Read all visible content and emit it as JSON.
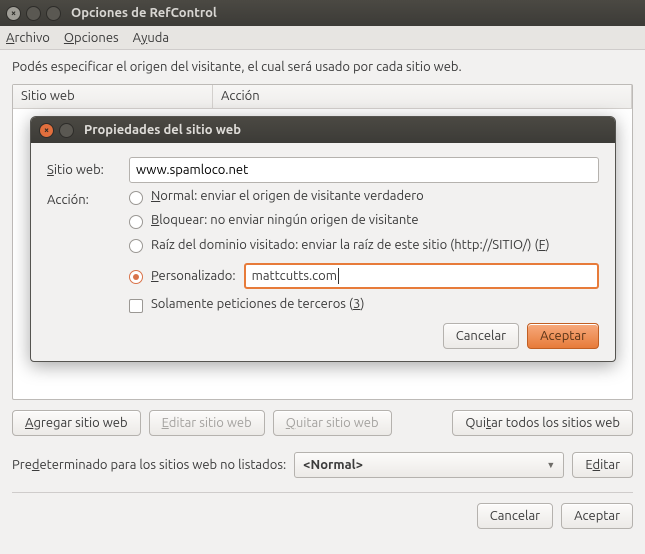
{
  "window": {
    "title": "Opciones de RefControl"
  },
  "menubar": {
    "file_html": "<u class='hint'>A</u>rchivo",
    "options_html": "<u class='hint'>O</u>pciones",
    "help_html": "A<u class='hint'>y</u>uda"
  },
  "main": {
    "description": "Podés especificar el origen del visitante, el cual será usado por cada sitio web.",
    "columns": {
      "site": "Sitio web",
      "action": "Acción"
    },
    "buttons": {
      "add_html": "<u class='hint'>A</u>gregar sitio web",
      "edit_html": "<u class='hint'>E</u>ditar sitio web",
      "remove_html": "<u class='hint'>Q</u>uitar sitio web",
      "remove_all_html": "Qui<u class='hint'>t</u>ar todos los sitios web"
    },
    "default_label_html": "Pre<u class='hint'>d</u>eterminado para los sitios web no listados:",
    "default_value": "<Normal>",
    "edit_default_html": "E<u class='hint'>d</u>itar",
    "cancel": "Cancelar",
    "accept": "Aceptar"
  },
  "dialog": {
    "title": "Propiedades del sitio web",
    "site_label_html": "<u class='hint'>S</u>itio web:",
    "site_value": "www.spamloco.net",
    "action_label": "Acción:",
    "opt_normal_html": "<u class='hint'>N</u>ormal: enviar el origen de visitante verdadero",
    "opt_block_html": "<u class='hint'>B</u>loquear: no enviar ningún origen de visitante",
    "opt_root_html": "Raíz del dominio visitado: enviar la raíz de este sitio (http://SITIO/) (<u class='hint'>F</u>)",
    "opt_custom_html": "<u class='hint'>P</u>ersonalizado:",
    "custom_value": "mattcutts.com",
    "third_party_html": "Solamente peticiones de terceros (<u class='hint'>3</u>)",
    "cancel": "Cancelar",
    "accept": "Aceptar"
  }
}
